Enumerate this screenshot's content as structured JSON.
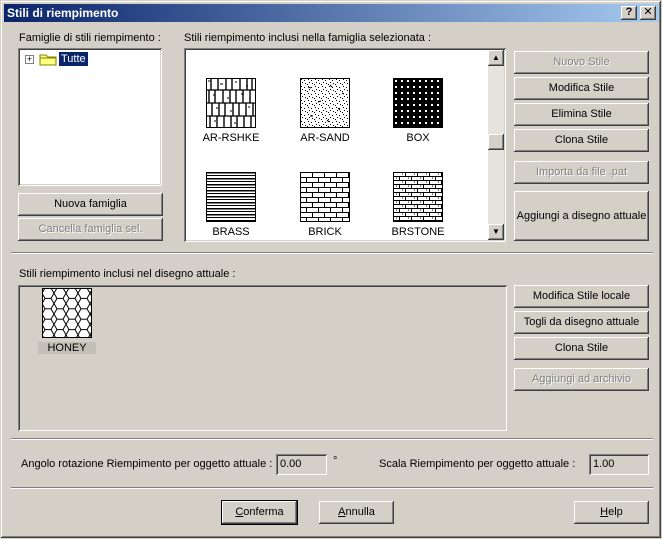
{
  "window": {
    "title": "Stili di riempimento",
    "help_glyph": "?",
    "close_glyph": "✕"
  },
  "families": {
    "label": "Famiglie di stili riempimento :",
    "tree_expander": "+",
    "tree_root": "Tutte",
    "new_family": "Nuova famiglia",
    "delete_family": "Cancella famiglia sel."
  },
  "library": {
    "label": "Stili riempimento inclusi nella famiglia selezionata :",
    "patterns": [
      "AR-RSHKE",
      "AR-SAND",
      "BOX",
      "BRASS",
      "BRICK",
      "BRSTONE"
    ],
    "scroll_up": "▲",
    "scroll_down": "▼"
  },
  "library_actions": {
    "new_style": "Nuovo Stile",
    "edit_style": "Modifica Stile",
    "delete_style": "Elimina Stile",
    "clone_style": "Clona Stile",
    "import_pat": "Importa da file .pat",
    "add_to_drawing": "Aggiungi a disegno attuale"
  },
  "drawing": {
    "label": "Stili riempimento inclusi nel disegno attuale :",
    "patterns": [
      "HONEY"
    ]
  },
  "drawing_actions": {
    "edit_local": "Modifica Stile locale",
    "remove_from_drawing": "Togli da disegno attuale",
    "clone_style": "Clona Stile",
    "add_to_archive": "Aggiungi ad archivio"
  },
  "settings": {
    "rotation_label": "Angolo rotazione Riempimento per oggetto attuale :",
    "rotation_value": "0.00",
    "rotation_unit": "°",
    "scale_label": "Scala Riempimento per oggetto attuale :",
    "scale_value": "1.00"
  },
  "footer": {
    "confirm_first": "C",
    "confirm_rest": "onferma",
    "cancel_first": "A",
    "cancel_rest": "nnulla",
    "help_first": "H",
    "help_rest": "elp"
  },
  "colors": {
    "face": "#d4d0c8",
    "title_start": "#0a246a",
    "title_end": "#a6caf0",
    "selection": "#0a246a"
  }
}
